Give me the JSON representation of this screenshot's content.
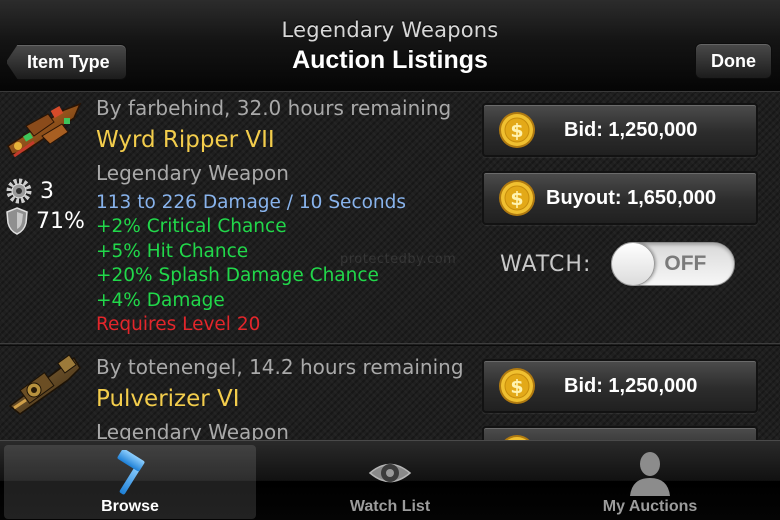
{
  "header": {
    "subtitle": "Legendary Weapons",
    "title": "Auction Listings",
    "back_label": "Item Type",
    "done_label": "Done"
  },
  "listings": [
    {
      "seller_line": "By farbehind, 32.0 hours remaining",
      "name": "Wyrd Ripper VII",
      "type": "Legendary Weapon",
      "sockets": "3",
      "durability": "71%",
      "damage": "113 to 226 Damage / 10 Seconds",
      "stats": [
        "+2% Critical Chance",
        "+5% Hit Chance",
        "+20% Splash Damage Chance",
        "+4% Damage"
      ],
      "requirement": "Requires Level 20",
      "bid_label": "Bid: 1,250,000",
      "buyout_label": "Buyout: 1,650,000",
      "watch_label": "WATCH:",
      "watch_state": "OFF"
    },
    {
      "seller_line": "By totenengel, 14.2 hours remaining",
      "name": "Pulverizer VI",
      "type": "Legendary Weapon",
      "bid_label": "Bid: 1,250,000"
    }
  ],
  "watermark": "protectedby.com",
  "tabs": [
    {
      "label": "Browse",
      "icon": "hammer-icon",
      "selected": true
    },
    {
      "label": "Watch List",
      "icon": "eye-icon",
      "selected": false
    },
    {
      "label": "My Auctions",
      "icon": "person-icon",
      "selected": false
    }
  ],
  "colors": {
    "item_name": "#f3cd4c",
    "damage_text": "#88b3ec",
    "stat_text": "#21d84a",
    "requirement_text": "#e3262b",
    "muted_text": "#a9a9a9",
    "coin_gold": "#e8b11f"
  }
}
